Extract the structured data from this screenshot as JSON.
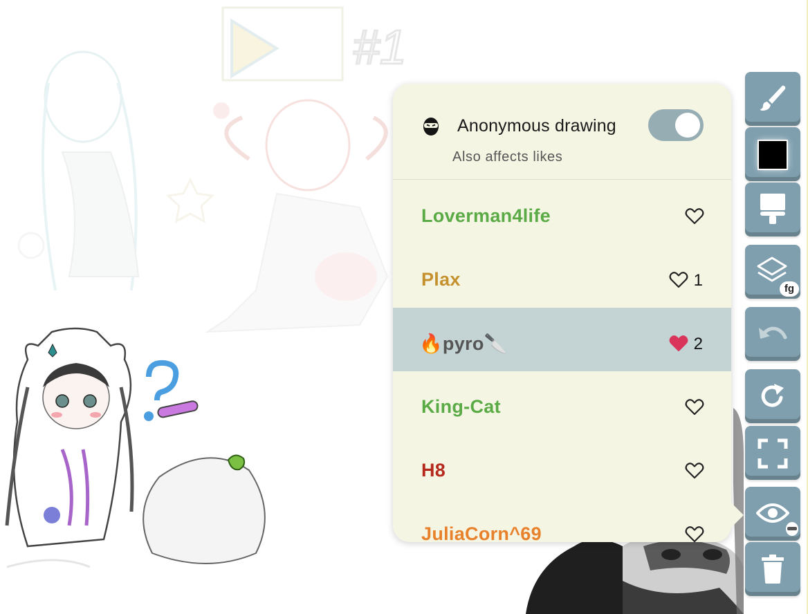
{
  "panel": {
    "anonymous": {
      "label": "Anonymous drawing",
      "sublabel": "Also affects likes",
      "icon": "ninja-icon",
      "enabled": true
    },
    "users": [
      {
        "name": "Loverman4life",
        "color": "#5aaa45",
        "likes": "",
        "liked": false
      },
      {
        "name": "Plax",
        "color": "#c4912e",
        "likes": "1",
        "liked": false
      },
      {
        "name_prefix": "🔥",
        "name": "pyro",
        "name_suffix": "🔪",
        "color": "#555555",
        "likes": "2",
        "liked": true,
        "selected": true
      },
      {
        "name": "King-Cat",
        "color": "#5aaa45",
        "likes": "",
        "liked": false
      },
      {
        "name": "H8",
        "color": "#b62a1d",
        "likes": "",
        "liked": false
      },
      {
        "name": "JuliaCorn^69",
        "color": "#e8812b",
        "likes": "",
        "liked": false
      }
    ]
  },
  "toolbar": {
    "tools": [
      {
        "name": "brush-tool",
        "icon": "paintbrush-icon"
      },
      {
        "name": "color-tool",
        "icon": "color-swatch",
        "color": "#000000"
      },
      {
        "name": "fill-tool",
        "icon": "paint-roller-icon"
      },
      {
        "name": "layer-tool",
        "icon": "layers-icon",
        "badge": "fg"
      },
      {
        "name": "undo-tool",
        "icon": "undo-icon"
      },
      {
        "name": "redo-tool",
        "icon": "redo-icon"
      },
      {
        "name": "fullscreen-tool",
        "icon": "expand-icon"
      },
      {
        "name": "visibility-tool",
        "icon": "eye-ninja-icon"
      },
      {
        "name": "delete-tool",
        "icon": "trash-icon"
      }
    ]
  },
  "canvas": {
    "marker_text": "#1"
  },
  "colors": {
    "panel_bg": "#f5f5e4",
    "selected_row": "#c4d3d4",
    "tool_bg": "#7f9fae",
    "toggle_on": "#96adb4",
    "liked_heart": "#d9345a"
  }
}
